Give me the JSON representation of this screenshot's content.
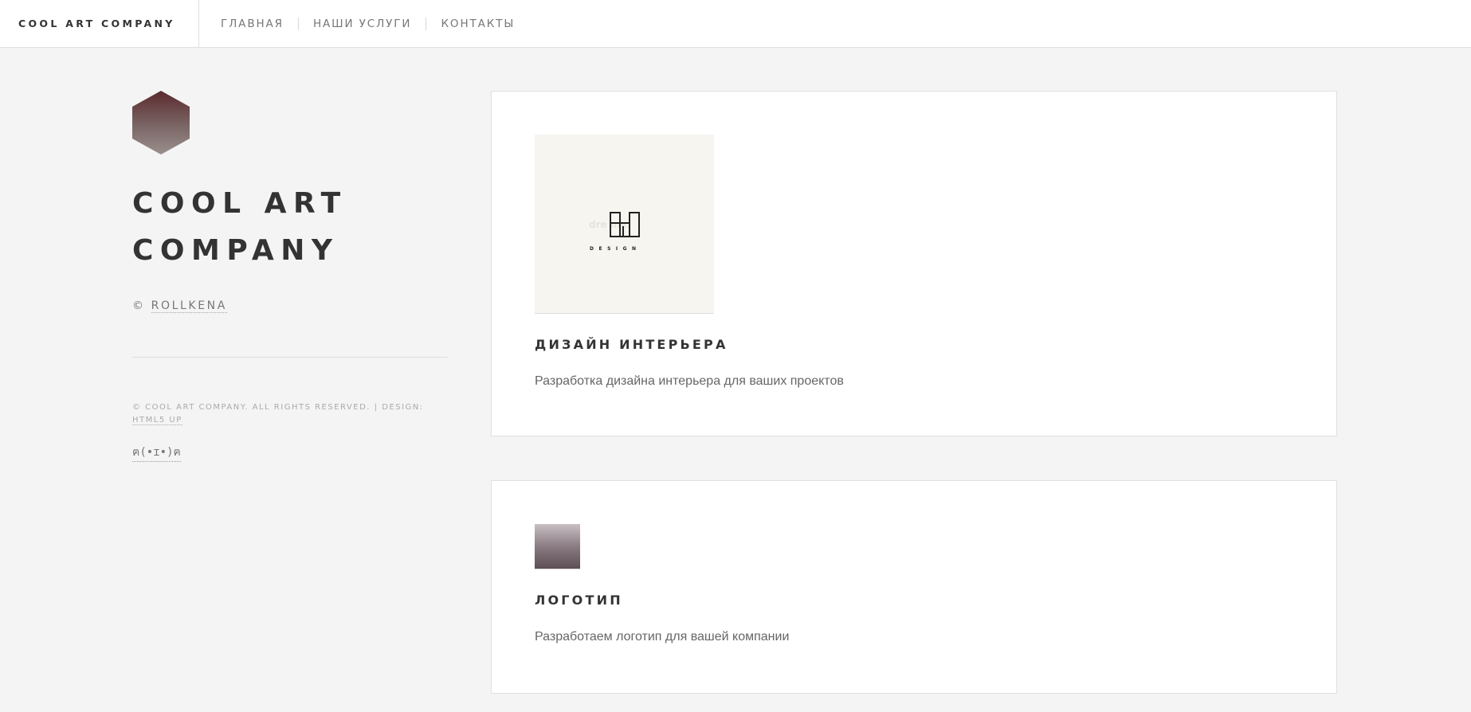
{
  "header": {
    "brand": "COOL ART COMPANY",
    "nav": [
      {
        "label": "ГЛАВНАЯ"
      },
      {
        "label": "НАШИ УСЛУГИ"
      },
      {
        "label": "КОНТАКТЫ"
      }
    ]
  },
  "sidebar": {
    "title_line1": "COOL ART",
    "title_line2": "COMPANY",
    "copyright_symbol": "©",
    "author": "ROLLKENA",
    "footer_text": "© COOL ART COMPANY. ALL RIGHTS RESERVED. | DESIGN:",
    "footer_link": "HTML5 UP",
    "emoticon": "ฅ(•ɪ•)ฅ"
  },
  "cards": [
    {
      "image_label": "DESIGN",
      "image_ghost_text": "dre   me.",
      "title": "ДИЗАЙН ИНТЕРЬЕРА",
      "description": "Разработка дизайна интерьера для ваших проектов"
    },
    {
      "title": "ЛОГОТИП",
      "description": "Разработаем логотип для вашей компании"
    }
  ],
  "colors": {
    "background": "#f4f4f4",
    "card_background": "#ffffff",
    "text_dark": "#333333",
    "hexagon_top": "#5b2a2e",
    "hexagon_bottom": "#9a8f8c"
  }
}
